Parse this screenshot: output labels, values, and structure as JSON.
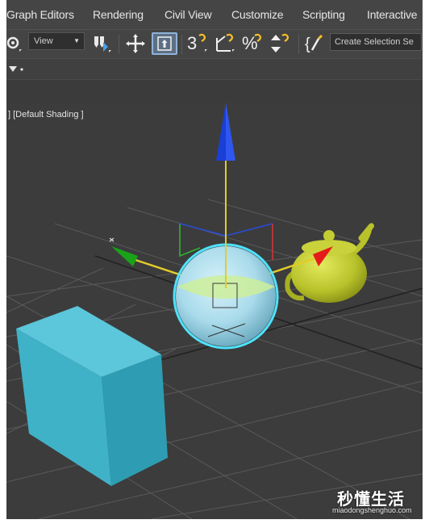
{
  "menubar": {
    "items": [
      "Graph Editors",
      "Rendering",
      "Civil View",
      "Customize",
      "Scripting",
      "Interactive"
    ]
  },
  "toolbar": {
    "view_select_value": "View",
    "selection_set_placeholder": "Create Selection Se",
    "icons": [
      "select-link-icon",
      "view-dropdown",
      "snap-icon",
      "move-icon",
      "select-manipulate-icon",
      "snap-3d-icon",
      "angle-snap-icon",
      "percent-snap-icon",
      "spinner-snap-icon",
      "edit-named-selection-icon"
    ]
  },
  "viewport": {
    "label": "] [Default Shading ]",
    "objects": [
      "box",
      "sphere",
      "teapot",
      "transform-gizmo",
      "grid"
    ],
    "colors": {
      "background": "#3c3c3c",
      "grid": "#5a5a5a",
      "box": "#3fb2c8",
      "sphere": "#a9dbeb",
      "sphere_selection_ring": "#4ee3ff",
      "teapot": "#b8c22a",
      "gizmo_x": "#e51b1b",
      "gizmo_y": "#19a319",
      "gizmo_z": "#1a3fd6"
    }
  },
  "watermark": {
    "main": "秒懂生活",
    "sub": "miaodongshenghuo.com"
  }
}
